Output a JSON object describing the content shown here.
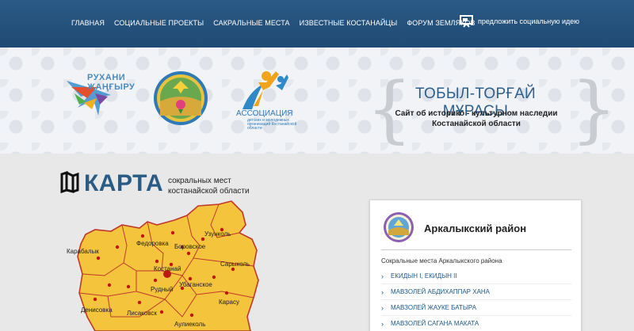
{
  "nav": {
    "items": [
      {
        "label": "ГЛАВНАЯ"
      },
      {
        "label": "СОЦИАЛЬНЫЕ ПРОЕКТЫ"
      },
      {
        "label": "САКРАЛЬНЫЕ МЕСТА"
      },
      {
        "label": "ИЗВЕСТНЫЕ КОСТАНАЙЦЫ"
      },
      {
        "label": "ФОРУМ ЗЕМЛЯКОВ"
      }
    ],
    "idea_label": "предложить социальную идею",
    "idea_icon": "presentation-board-icon"
  },
  "banner": {
    "logo1_line1": "РУХАНИ",
    "logo1_line2": "ЖАҢҒЫРУ",
    "logo3_title": "АССОЦИАЦИЯ",
    "logo3_caption": "детских и молодежных организаций Костанайской области",
    "site_title": "ТОБЫЛ-ТОРҒАЙ МҰРАСЫ",
    "site_subtitle_1": "Сайт об историко - культурном наследии",
    "site_subtitle_2": "Костанайской области"
  },
  "map": {
    "heading": "КАРТА",
    "subtitle_1": "сокральных мест",
    "subtitle_2": "костанайской области",
    "districts": [
      {
        "name": "Карабалык"
      },
      {
        "name": "Федоровка"
      },
      {
        "name": "Боровское"
      },
      {
        "name": "Узунколь"
      },
      {
        "name": "Костанай"
      },
      {
        "name": "Сарыколь"
      },
      {
        "name": "Убаганское"
      },
      {
        "name": "Рудный"
      },
      {
        "name": "Карасу"
      },
      {
        "name": "Денисовка"
      },
      {
        "name": "Лисаковск"
      },
      {
        "name": "Аулиеколь"
      }
    ],
    "colors": {
      "fill": "#f4c43c",
      "stroke": "#c0392b",
      "dot": "#c0180f"
    }
  },
  "card": {
    "title": "Аркалыкский район",
    "subtitle": "Сокральные места Аркалыкского района",
    "items": [
      {
        "label": "ЕКИДЫН I, ЕКИДЫН II"
      },
      {
        "label": "МАВЗОЛЕЙ АБДИХАППАР ХАНА"
      },
      {
        "label": "МАВЗОЛЕЙ ЖАУКЕ БАТЫРА"
      },
      {
        "label": "МАВЗОЛЕЙ САГАНА МАКАТА"
      }
    ]
  }
}
